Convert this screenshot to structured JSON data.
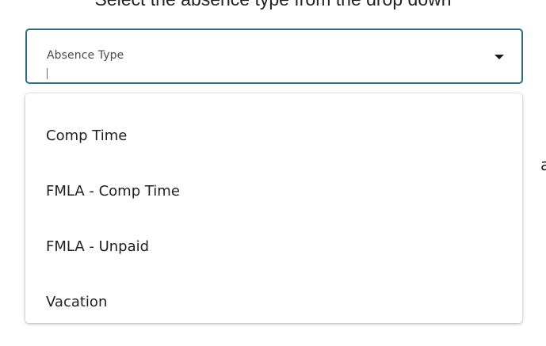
{
  "instruction": "Select the absence type from the drop down",
  "absence_select": {
    "label": "Absence Type",
    "value": "",
    "expanded": true,
    "chevron_icon": "chevron-down-icon",
    "border_color": "#2c6f86"
  },
  "options": [
    {
      "label": "Comp Time"
    },
    {
      "label": "FMLA - Comp Time"
    },
    {
      "label": "FMLA - Unpaid"
    },
    {
      "label": "Vacation"
    }
  ],
  "background_text": "a"
}
